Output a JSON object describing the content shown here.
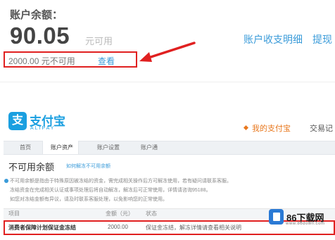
{
  "balance": {
    "label": "账户余额：",
    "amount": "90.05",
    "unit": "元可用",
    "unavailable_text": "2000.00 元不可用",
    "view_link": "查看"
  },
  "top_links": {
    "detail": "账户收支明细",
    "withdraw": "提现"
  },
  "logo": {
    "icon_glyph": "支",
    "name_cn": "支付宝",
    "name_en": "ALIPAY"
  },
  "header_nav": {
    "my_alipay": "我的支付宝",
    "trade_record": "交易记"
  },
  "tabs": [
    {
      "label": "首页",
      "active": false
    },
    {
      "label": "账户资产",
      "active": true
    },
    {
      "label": "账户设置",
      "active": false
    },
    {
      "label": "账户通",
      "active": false
    }
  ],
  "section": {
    "title": "不可用余额",
    "link": "如何解冻不可用余额"
  },
  "notes": [
    "不可用余额是指由于特殊原因被冻结的资金，需完成相关操作后方可解冻使用，若有疑问请联系客服。",
    "冻结资金在完成相关认证或事项处理后将自动解冻，解冻后可正常使用，详情请咨询95188。",
    "如您对冻结金额有异议，请及时联系客服处理，以免影响您的正常使用。"
  ],
  "table": {
    "headers": [
      "项目",
      "金额（元）",
      "状态"
    ],
    "rows": [
      {
        "item": "消费者保障计划保证金冻结",
        "amount": "2000.00",
        "status": "保证金冻结，解冻详情请查看相关说明"
      }
    ]
  },
  "watermark": {
    "brand": "86下载网",
    "site": "www.86down.com"
  },
  "colors": {
    "link_blue": "#3a9bd9",
    "alipay_blue": "#1a9fe0",
    "annotation_red": "#e02020",
    "nav_orange": "#e8781e"
  }
}
